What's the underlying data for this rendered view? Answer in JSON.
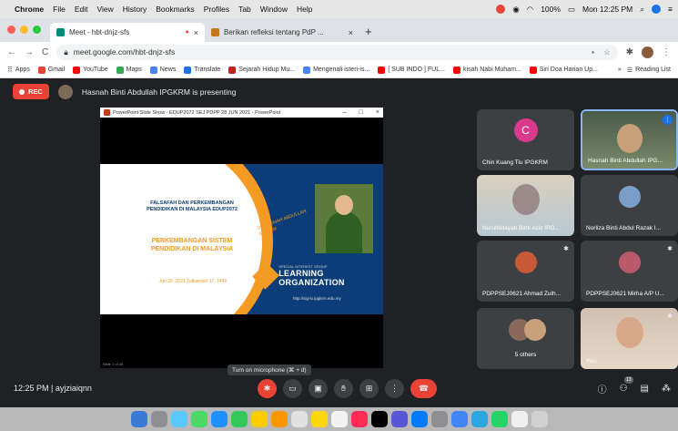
{
  "menubar": {
    "app": "Chrome",
    "items": [
      "File",
      "Edit",
      "View",
      "History",
      "Bookmarks",
      "Profiles",
      "Tab",
      "Window",
      "Help"
    ],
    "battery": "100%",
    "clock": "Mon 12:25 PM"
  },
  "tabs": [
    {
      "title": "Meet - hbt-dnjz-sfs",
      "active": true
    },
    {
      "title": "Berikan refleksi tentang PdP ...",
      "active": false
    }
  ],
  "address": {
    "url": "meet.google.com/hbt-dnjz-sfs"
  },
  "bookmarks": {
    "items": [
      "Apps",
      "Gmail",
      "YouTube",
      "Maps",
      "News",
      "Translate",
      "Sejarah Hidup Mu...",
      "Mengenali isteri-is...",
      "[ SUB INDO ] FUL...",
      "kisah Nabi Muham...",
      "Siri Doa Harian Up..."
    ],
    "reading_list": "Reading List"
  },
  "meet": {
    "rec_label": "REC",
    "presenting_text": "Hasnah Binti Abdullah IPGKRM is presenting",
    "slide": {
      "window_title": "PowerPoint Slide Show - EDUP2072 SEJ PDPP 28 JUN 2021 - PowerPoint",
      "title_lines": "FALSAFAH DAN PERKEMBANGAN PENDIDIKAN DI MALAYSIA EDUP2072",
      "subtitle": "PERKEMBANGAN SISTEM PENDIDIKAN DI MALAYSIA",
      "date": "Jun 28, 2021 Zulkaedah 17, 1442",
      "presenter": "DR HASNAH ABDULLAH IPGKRM",
      "org": "LEARNING ORGANIZATION",
      "org_sub": "SPECIAL INTEREST GROUP",
      "url": "http://sig-lo.ipgkrm.edu.my",
      "footer": "Slide 1 of 26"
    },
    "participants": [
      {
        "name": "Chin Kuang Tiu IPGKRM",
        "avatar_letter": "C"
      },
      {
        "name": "Hasnah Binti Abdullah IPG..."
      },
      {
        "name": "Nurulhidayah Binti Aziz IPG..."
      },
      {
        "name": "Norliza Binti Abdul Razak I..."
      },
      {
        "name": "PDPPSEJ0621 Ahmad Zulh..."
      },
      {
        "name": "PDPPSEJ0621 Mirha A/P U..."
      },
      {
        "name": "5 others"
      },
      {
        "name": "You"
      }
    ],
    "time": "12:25 PM",
    "meeting_code": "ayjziaiqnn",
    "tooltip": "Turn on microphone (⌘ + d)",
    "people_count": "13"
  },
  "colors": {
    "rec": "#ea4335",
    "accent": "#1a73e8",
    "bg": "#202124"
  }
}
